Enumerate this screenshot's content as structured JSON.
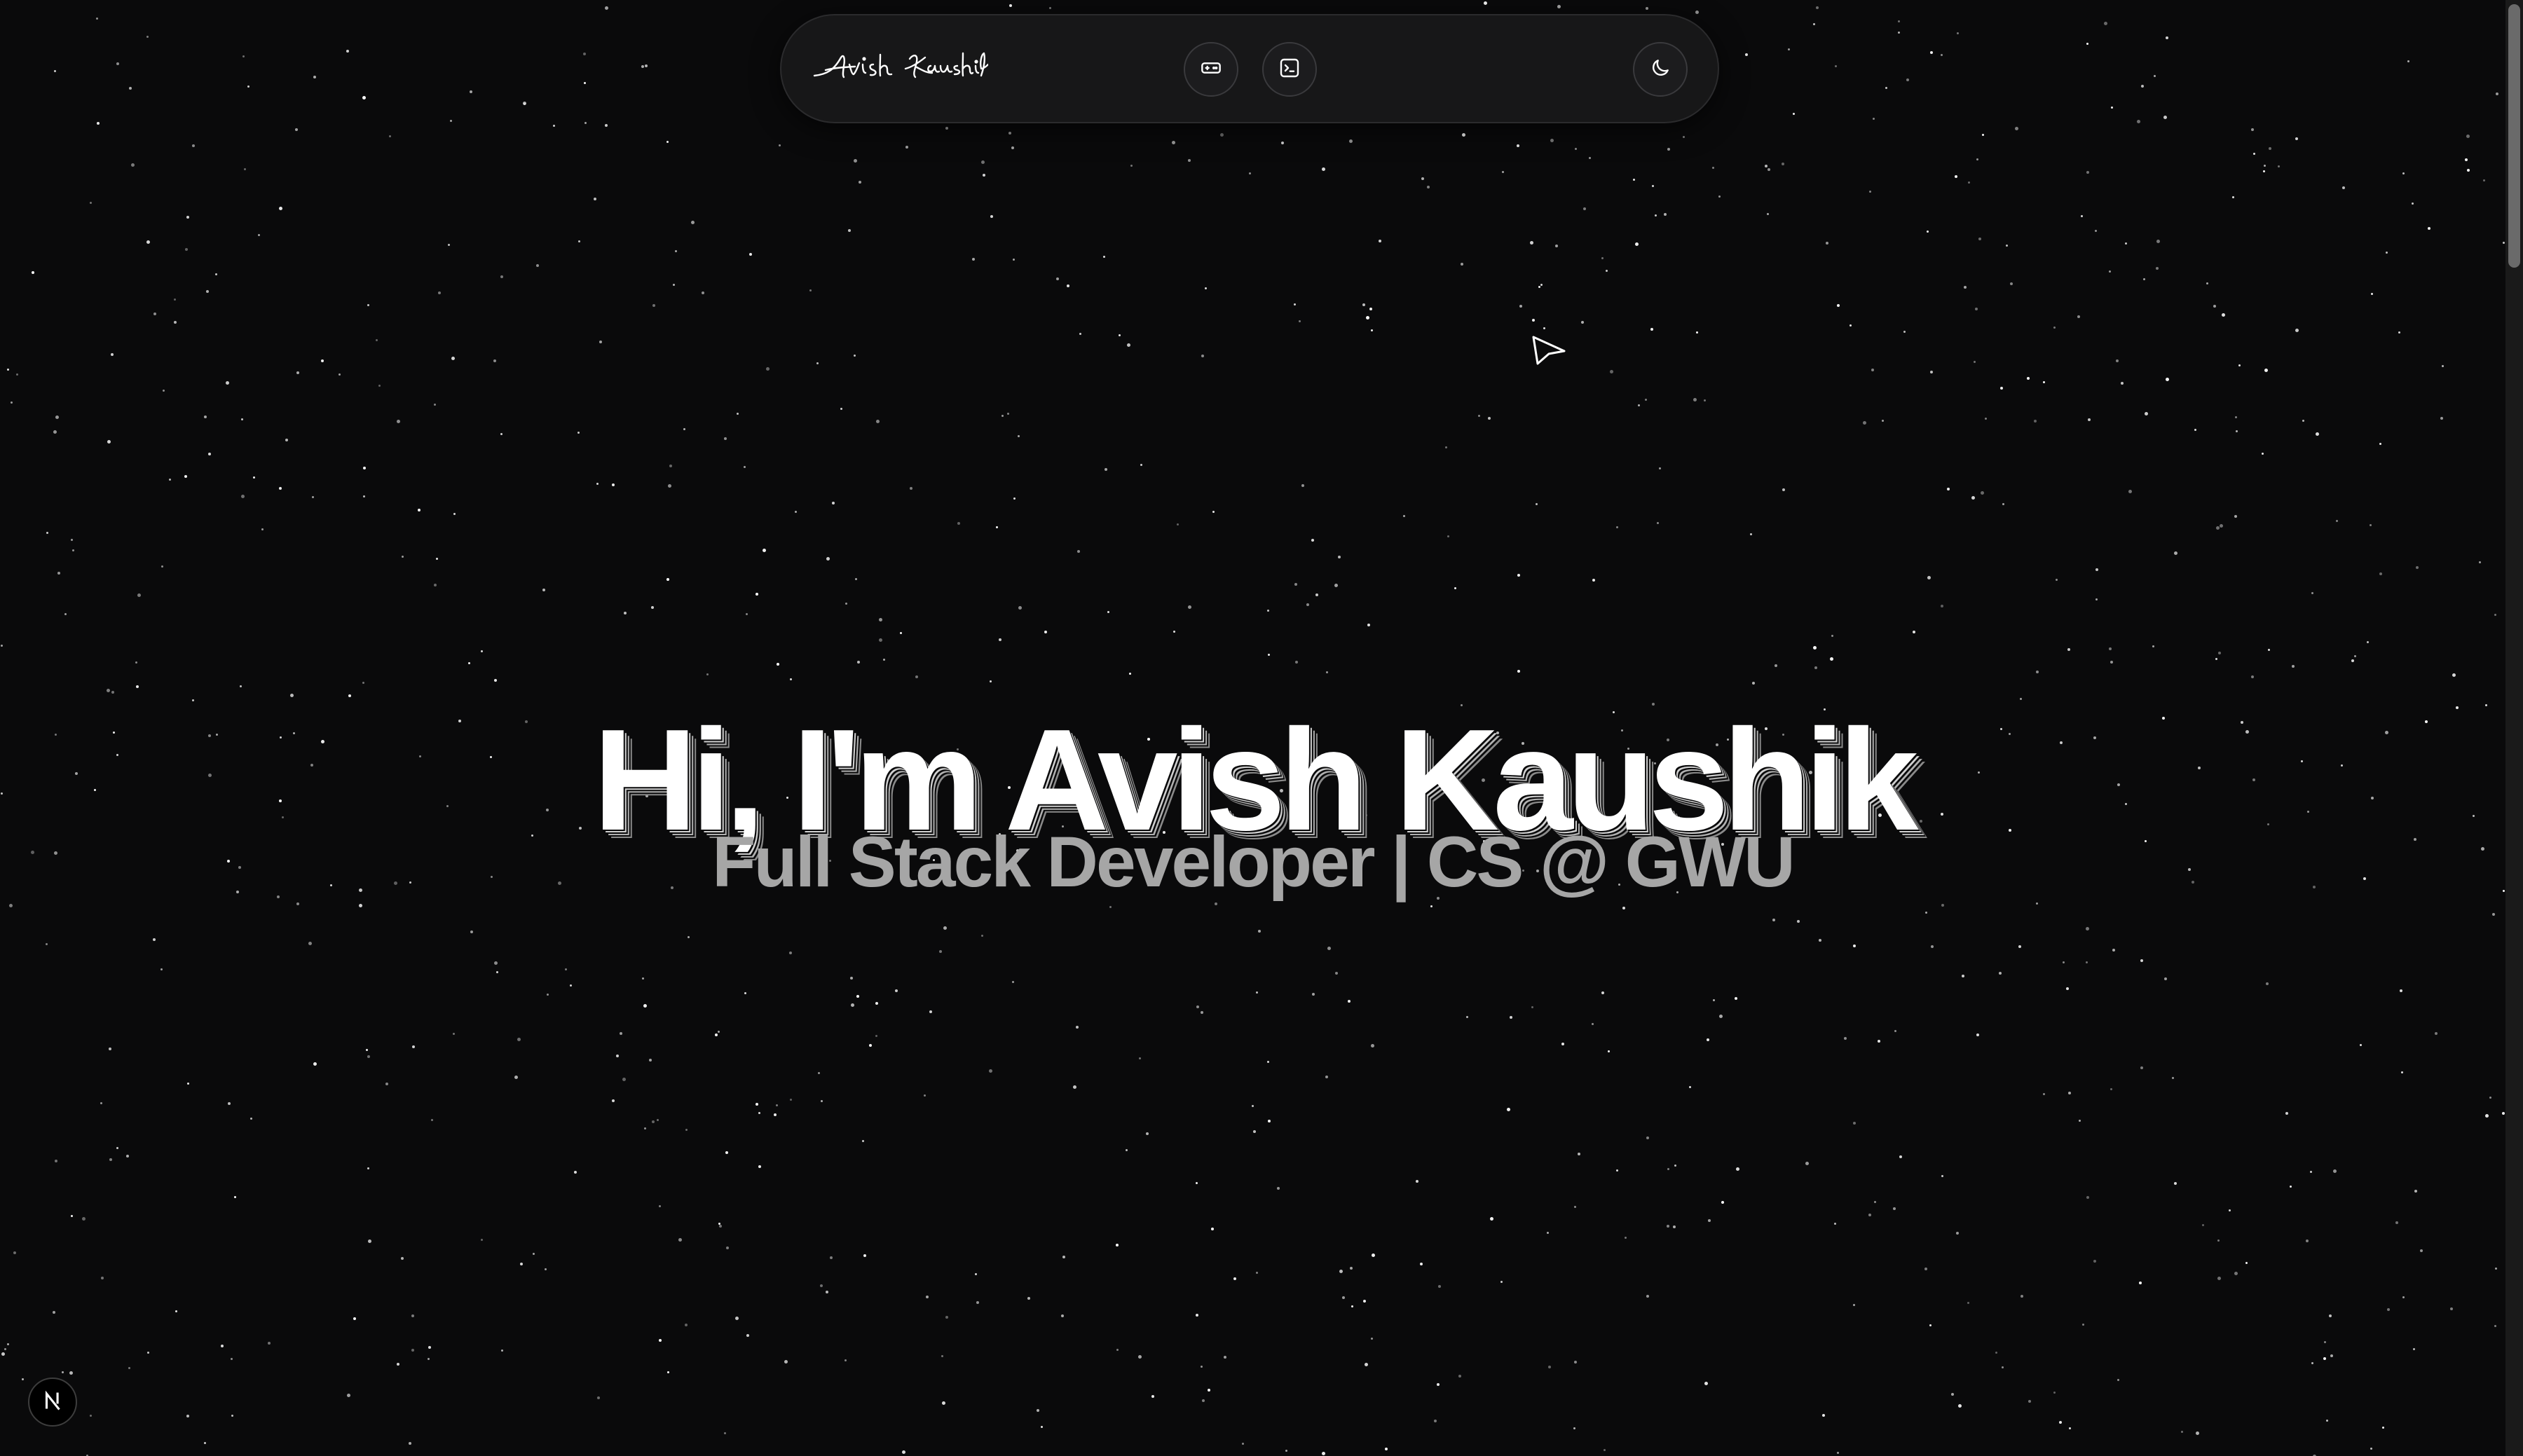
{
  "navbar": {
    "logo_text": "Avish Kaushik",
    "buttons": [
      {
        "name": "game",
        "icon": "gamepad-icon"
      },
      {
        "name": "terminal",
        "icon": "terminal-icon"
      },
      {
        "name": "theme",
        "icon": "moon-icon"
      }
    ]
  },
  "hero": {
    "title": "Hi, I'm Avish Kaushik",
    "subtitle": "Full Stack Developer | CS @ GWU"
  },
  "dev_indicator": {
    "label": "N",
    "icon": "nextjs-logo-icon"
  },
  "colors": {
    "background": "#0a0a0b",
    "navbar_bg": "#171718",
    "title": "#ffffff",
    "subtitle": "#a6a6a6",
    "stars": "#ffffff"
  }
}
